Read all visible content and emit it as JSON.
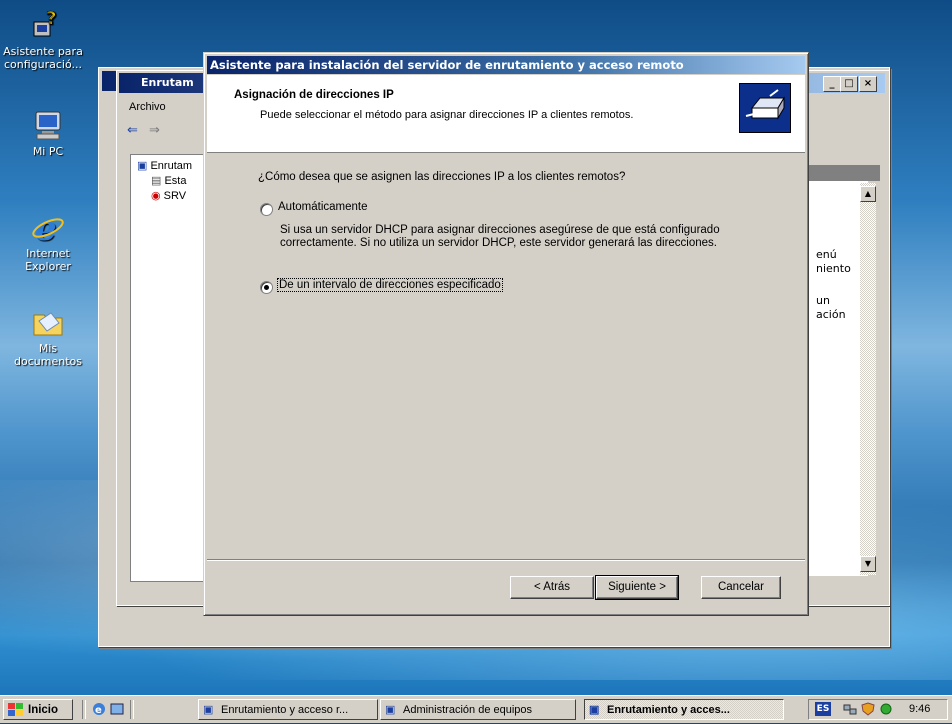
{
  "desktop": {
    "icons": [
      {
        "label": "Asistente para configuració...",
        "icon": "wizard-icon"
      },
      {
        "label": "Mi PC",
        "icon": "computer-icon"
      },
      {
        "label": "Internet Explorer",
        "icon": "ie-icon"
      },
      {
        "label": "Mis documentos",
        "icon": "folder-icon"
      }
    ]
  },
  "mmc": {
    "title": "Enrutam",
    "menu_archivo": "Archivo",
    "tree_root": "Enrutam",
    "tree_item1": "Esta",
    "tree_item2": "SRV",
    "right_text1": "enú",
    "right_text2": "niento",
    "right_text3": "un",
    "right_text4": "ación"
  },
  "wizard": {
    "title": "Asistente para instalación del servidor de enrutamiento y acceso remoto",
    "header_title": "Asignación de direcciones IP",
    "header_subtitle": "Puede seleccionar el método para asignar direcciones IP a clientes remotos.",
    "question": "¿Cómo desea que se asignen las direcciones IP a los clientes remotos?",
    "option_auto": "Automáticamente",
    "option_auto_desc": "Si usa un servidor DHCP para asignar direcciones asegúrese de que está configurado correctamente. Si no utiliza un servidor DHCP, este servidor generará las direcciones.",
    "option_range": "De un intervalo de direcciones especificado",
    "selected": "range",
    "btn_back": "< Atrás",
    "btn_next": "Siguiente >",
    "btn_cancel": "Cancelar"
  },
  "taskbar": {
    "start": "Inicio",
    "tasks": [
      {
        "label": "Enrutamiento y acceso r...",
        "active": false
      },
      {
        "label": "Administración de equipos",
        "active": false
      },
      {
        "label": "Enrutamiento y acces...",
        "active": true
      }
    ],
    "lang": "ES",
    "clock": "9:46"
  }
}
